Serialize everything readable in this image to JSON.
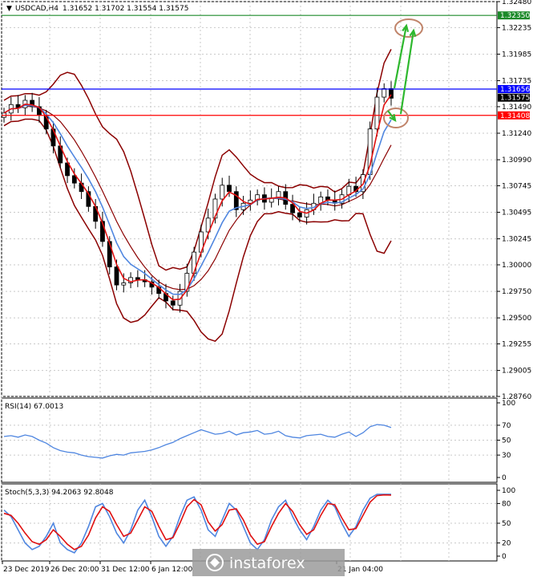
{
  "chart_data": {
    "type": "candlestick",
    "symbol_header": "USDCAD,H4",
    "ohlc_header": "1.31652 1.31702 1.31554 1.31575",
    "header": {
      "symbol": "USDCAD,H4",
      "ohlc": "1.31652 1.31702 1.31554 1.31575"
    },
    "price_axis": {
      "ylim": [
        1.2876,
        1.3248
      ],
      "ticks": [
        "1.32480",
        "1.32235",
        "1.31985",
        "1.31735",
        "1.31490",
        "1.31240",
        "1.30990",
        "1.30745",
        "1.30495",
        "1.30245",
        "1.30000",
        "1.29750",
        "1.29500",
        "1.29255",
        "1.29005",
        "1.28760"
      ]
    },
    "time_axis": {
      "labels": [
        "23 Dec 2019",
        "26 Dec 20:00",
        "31 Dec 12:00",
        "6 Jan 12:00",
        "21 Jan 04:00"
      ]
    },
    "levels": [
      {
        "label": "1.32350",
        "value": 1.3235,
        "color": "#1c8a2a"
      },
      {
        "label": "1.31656",
        "value": 1.31656,
        "color": "#0000ff"
      },
      {
        "label": "1.31575",
        "value": 1.31575,
        "color": "#000000"
      },
      {
        "label": "1.31408",
        "value": 1.31408,
        "color": "#ff0000"
      }
    ],
    "close_series": [
      1.3143,
      1.3151,
      1.3148,
      1.3155,
      1.3149,
      1.3141,
      1.3128,
      1.3112,
      1.3096,
      1.3084,
      1.3077,
      1.3069,
      1.3055,
      1.3041,
      1.3022,
      1.2998,
      1.2981,
      1.2983,
      1.2988,
      1.2986,
      1.2984,
      1.2979,
      1.2973,
      1.2966,
      1.2962,
      1.2975,
      1.2992,
      1.3012,
      1.3031,
      1.3044,
      1.3062,
      1.3075,
      1.3069,
      1.3052,
      1.3058,
      1.3061,
      1.3066,
      1.3059,
      1.3063,
      1.3069,
      1.3057,
      1.3049,
      1.3045,
      1.3052,
      1.3058,
      1.3064,
      1.3061,
      1.3058,
      1.3066,
      1.3074,
      1.3069,
      1.3085,
      1.3128,
      1.3158,
      1.3166,
      1.3157
    ],
    "rsi": {
      "label": "RSI(14) 67.0013",
      "ticks": [
        "100",
        "70",
        "50",
        "30",
        "0"
      ],
      "levels": [
        70,
        50,
        30
      ],
      "values": [
        55,
        56,
        54,
        57,
        55,
        50,
        46,
        40,
        36,
        34,
        33,
        30,
        28,
        27,
        26,
        29,
        31,
        30,
        33,
        34,
        35,
        37,
        40,
        44,
        47,
        52,
        56,
        60,
        64,
        61,
        58,
        59,
        62,
        57,
        60,
        61,
        63,
        58,
        59,
        62,
        56,
        54,
        53,
        56,
        57,
        58,
        55,
        54,
        58,
        61,
        55,
        60,
        68,
        71,
        70,
        67
      ]
    },
    "stoch": {
      "label": "Stoch(5,3,3) 94.2063 92.8048",
      "ticks": [
        "100",
        "80",
        "50",
        "20",
        "0"
      ],
      "levels": [
        80,
        50,
        20
      ],
      "main": [
        70,
        60,
        40,
        20,
        10,
        15,
        30,
        50,
        20,
        10,
        5,
        20,
        45,
        75,
        80,
        60,
        35,
        20,
        40,
        70,
        85,
        60,
        30,
        15,
        30,
        60,
        85,
        90,
        70,
        40,
        30,
        55,
        80,
        70,
        45,
        20,
        10,
        25,
        55,
        75,
        85,
        60,
        40,
        25,
        45,
        70,
        85,
        75,
        50,
        30,
        45,
        70,
        88,
        94,
        94,
        94
      ],
      "signal": [
        65,
        62,
        50,
        35,
        22,
        18,
        25,
        40,
        30,
        18,
        10,
        15,
        32,
        58,
        75,
        68,
        48,
        30,
        35,
        55,
        75,
        68,
        45,
        25,
        28,
        50,
        75,
        86,
        78,
        52,
        38,
        48,
        70,
        72,
        55,
        32,
        18,
        22,
        45,
        65,
        80,
        68,
        48,
        33,
        40,
        62,
        80,
        78,
        58,
        40,
        42,
        62,
        82,
        92,
        93,
        92.8
      ]
    },
    "watermark": "instaforex"
  }
}
